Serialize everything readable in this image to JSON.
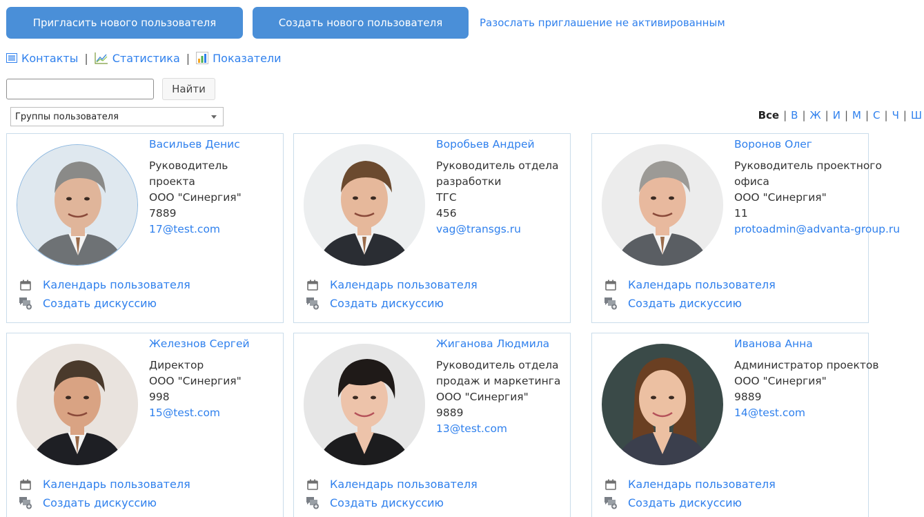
{
  "toolbar": {
    "invite_label": "Пригласить нового пользователя",
    "create_label": "Создать нового пользователя",
    "resend_label": "Разослать приглашение не активированным"
  },
  "views": {
    "contacts": "Контакты",
    "stats": "Статистика",
    "metrics": "Показатели",
    "separator": "|"
  },
  "search": {
    "value": "",
    "placeholder": "",
    "button": "Найти"
  },
  "groups": {
    "selected": "Группы пользователя"
  },
  "alphabet": {
    "all": "Все",
    "letters": [
      "В",
      "Ж",
      "И",
      "М",
      "С",
      "Ч",
      "Ш"
    ],
    "separator": "|"
  },
  "actions": {
    "calendar": "Календарь пользователя",
    "discussion": "Создать дискуссию"
  },
  "users": [
    {
      "name": "Васильев Денис",
      "lines": [
        "Руководитель",
        "проекта",
        "ООО \"Синергия\"",
        "7889"
      ],
      "email": "17@test.com",
      "avatar": "man-gray-suit",
      "skin": "#e0b59a",
      "hair": "#8a8a88",
      "suit": "#6e7275",
      "bg": "#dfe8ef"
    },
    {
      "name": "Воробьев Андрей",
      "lines": [
        "Руководитель отдела",
        "разработки",
        "ТГС",
        "456"
      ],
      "email": "vag@transgs.ru",
      "avatar": "man-dark-suit",
      "skin": "#e6b89b",
      "hair": "#6b4a2f",
      "suit": "#2a2d33",
      "bg": "#eceeef"
    },
    {
      "name": "Воронов Олег",
      "lines": [
        "Руководитель проектного",
        "офиса",
        "ООО \"Синергия\"",
        "11"
      ],
      "email": "protoadmin@advanta-group.ru",
      "avatar": "man-gray-beard",
      "skin": "#e8b99e",
      "hair": "#9c9a96",
      "suit": "#5a5e63",
      "bg": "#ececec"
    },
    {
      "name": "Железнов Сергей",
      "lines": [
        "Директор",
        "ООО \"Синергия\"",
        "998"
      ],
      "email": "15@test.com",
      "avatar": "man-black-suit",
      "skin": "#d9a383",
      "hair": "#4a3a2c",
      "suit": "#1e1f24",
      "bg": "#e9e3de"
    },
    {
      "name": "Жиганова Людмила",
      "lines": [
        "Руководитель отдела",
        "продаж и маркетинга",
        "ООО \"Синергия\"",
        "9889"
      ],
      "email": "13@test.com",
      "avatar": "woman-short-hair",
      "skin": "#edc3aa",
      "hair": "#1f1a18",
      "suit": "#1c1c1e",
      "bg": "#e6e6e6"
    },
    {
      "name": "Иванова Анна",
      "lines": [
        "Администратор проектов",
        "ООО \"Синергия\"",
        "9889"
      ],
      "email": "14@test.com",
      "avatar": "woman-long-hair",
      "skin": "#ecc0a2",
      "hair": "#6a3f22",
      "suit": "#3b3f4d",
      "bg": "#3a4a48"
    }
  ],
  "colors": {
    "accent": "#2f80ed",
    "button": "#4a8fd8",
    "card_border": "#c9dcea"
  }
}
